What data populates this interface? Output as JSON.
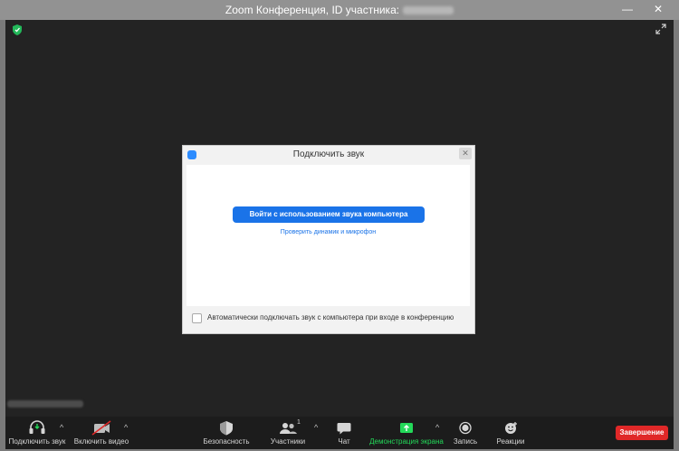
{
  "window": {
    "title": "Zoom Конференция, ID участника:",
    "minimize_glyph": "—",
    "close_glyph": "✕"
  },
  "dialog": {
    "title": "Подключить звук",
    "primary_button": "Войти с использованием звука компьютера",
    "test_link": "Проверить динамик и микрофон",
    "auto_join_checkbox": {
      "label": "Автоматически подключать звук с компьютера при входе в конференцию",
      "checked": false
    },
    "close_glyph": "✕"
  },
  "toolbar": {
    "items": [
      {
        "label": "Подключить звук",
        "icon": "headphones-icon"
      },
      {
        "label": "Включить видео",
        "icon": "camera-off-icon"
      },
      {
        "label": "Безопасность",
        "icon": "shield-icon"
      },
      {
        "label": "Участники",
        "icon": "participants-icon",
        "count": "1"
      },
      {
        "label": "Чат",
        "icon": "chat-icon"
      },
      {
        "label": "Демонстрация экрана",
        "icon": "share-screen-icon"
      },
      {
        "label": "Запись",
        "icon": "record-icon"
      },
      {
        "label": "Реакции",
        "icon": "reactions-icon"
      }
    ],
    "caret_glyph": "^",
    "end_button": "Завершение"
  },
  "colors": {
    "accent": "#1a73e8",
    "share_green": "#23d959",
    "end_red": "#e02828",
    "stage": "#232323"
  }
}
